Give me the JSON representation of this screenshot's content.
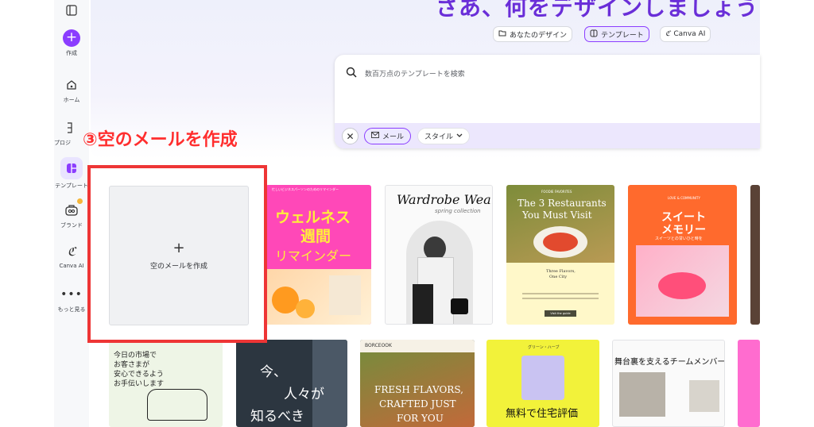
{
  "sidebar": {
    "items": [
      {
        "label": "作成"
      },
      {
        "label": "ホーム"
      },
      {
        "label": "プロジ"
      },
      {
        "label": "テンプレート"
      },
      {
        "label": "ブランド"
      },
      {
        "label": "Canva AI"
      },
      {
        "label": "もっと見る"
      }
    ]
  },
  "header": {
    "headline": "さあ、何をデザインしましょう",
    "tabs": [
      {
        "label": "あなたのデザイン"
      },
      {
        "label": "テンプレート"
      },
      {
        "label": "Canva AI"
      }
    ]
  },
  "search": {
    "placeholder": "数百万点のテンプレートを検索",
    "filters": [
      {
        "label": "メール"
      },
      {
        "label": "スタイル"
      }
    ]
  },
  "annotation": {
    "text": "③空のメールを作成"
  },
  "blank": {
    "plus": "+",
    "label": "空のメールを作成"
  },
  "templates": {
    "wellness": {
      "small": "忙しいビジネスパーソンのためのリマインダー",
      "line1": "ウェルネス",
      "line2": "週間",
      "line3": "リマインダー"
    },
    "wardrobe": {
      "title": "Wardrobe Wear",
      "sub": "spring collection"
    },
    "restaurants": {
      "kicker": "FOODIE FAVORITES",
      "title1": "The 3 Restaurants",
      "title2": "You Must Visit",
      "sub1": "Three Flavors,",
      "sub2": "One City",
      "btn": "Visit the guide"
    },
    "sweet": {
      "kicker": "LOVE & COMMUNITY",
      "line1": "スイート",
      "line2": "メモリー",
      "sub": "スイーツとの甘いひと時を"
    },
    "market": {
      "lines": [
        "今日の市場で",
        "お客さまが",
        "安心できるよう",
        "お手伝いします"
      ]
    },
    "city": {
      "line1": "今、",
      "line2": "人々が",
      "line3": "知るべき"
    },
    "fresh": {
      "brand": "BORCEOOK",
      "line1": "FRESH FLAVORS,",
      "line2": "CRAFTED JUST",
      "line3": "FOR YOU"
    },
    "home": {
      "kicker": "グリーン・ハーブ",
      "title": "無料で住宅評価"
    },
    "team": {
      "title": "舞台裏を支えるチームメンバー"
    }
  },
  "colors": {
    "accent": "#8b3dff",
    "annotation": "#ee3535",
    "wellness_bg": "#ff48b8",
    "home_bg": "#f2f23a",
    "sweet_bg": "#ff6a2d"
  }
}
